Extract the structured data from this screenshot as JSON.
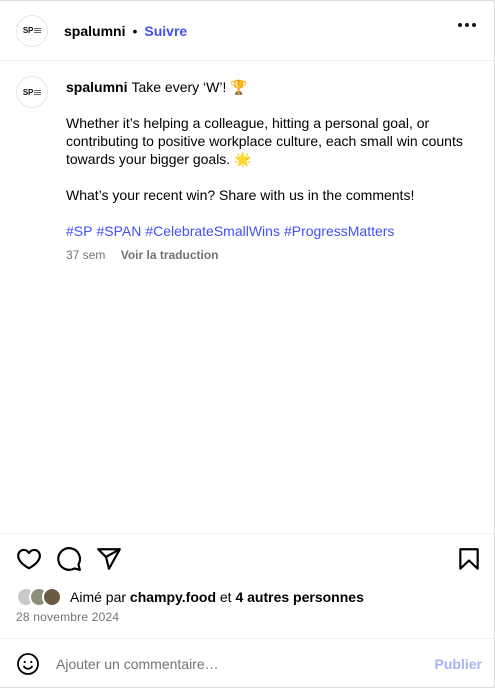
{
  "header": {
    "username": "spalumni",
    "separator": "•",
    "follow_label": "Suivre",
    "avatar_mono": "SP"
  },
  "caption": {
    "username": "spalumni",
    "title_line": "Take every ‘W’! 🏆",
    "paragraph1": "Whether it’s helping a colleague, hitting a personal goal, or contributing to positive workplace culture, each small win counts towards your bigger goals. 🌟",
    "paragraph2": "What’s your recent win? Share with us in the comments!",
    "hashtags": [
      "#SP",
      "#SPAN",
      "#CelebrateSmallWins",
      "#ProgressMatters"
    ],
    "age": "37 sem",
    "translate_label": "Voir la traduction"
  },
  "actions": {
    "like_icon": "heart-icon",
    "comment_icon": "comment-icon",
    "share_icon": "send-icon",
    "save_icon": "bookmark-icon"
  },
  "likes": {
    "prefix": "Aimé par",
    "user": "champy.food",
    "connector": "et",
    "others": "4 autres personnes"
  },
  "date": "28 novembre 2024",
  "comment": {
    "placeholder": "Ajouter un commentaire…",
    "publish_label": "Publier",
    "emoji_icon": "smiley-icon"
  },
  "colors": {
    "link": "#4150f7",
    "muted": "#737373",
    "publish_disabled": "#a5b3f9"
  }
}
